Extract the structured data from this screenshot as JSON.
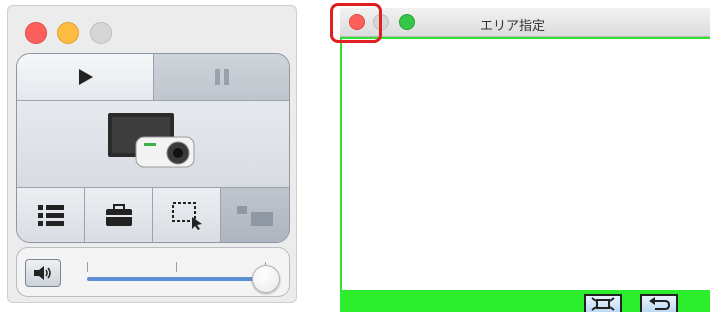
{
  "control_window": {
    "traffic_lights": [
      "close",
      "minimize",
      "zoom"
    ],
    "buttons": {
      "play": "play-icon",
      "pause": "pause-icon",
      "display": "projector-display-icon",
      "list": "list-icon",
      "toolbox": "toolbox-icon",
      "area_select": "area-select-icon",
      "fullscreen": "screen-resize-icon"
    },
    "volume": {
      "speaker_icon": "speaker-icon",
      "level": 0.95
    }
  },
  "area_window": {
    "title": "エリア指定",
    "traffic_lights": [
      "close",
      "minimize",
      "zoom"
    ],
    "bottom_buttons": [
      "fit-area-icon",
      "back-icon"
    ]
  },
  "colors": {
    "accent_green": "#2dee2d",
    "highlight_red": "#e02020"
  }
}
